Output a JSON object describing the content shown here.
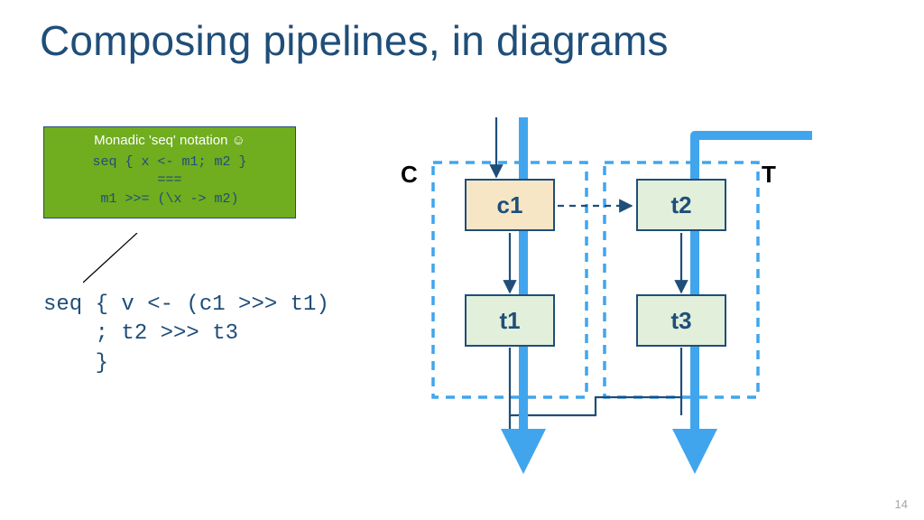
{
  "slide": {
    "title": "Composing pipelines, in diagrams",
    "page_number": "14"
  },
  "callout": {
    "title": "Monadic 'seq' notation ☺",
    "line1": "seq { x <- m1; m2 }",
    "line2": "===",
    "line3": "m1 >>= (\\x -> m2)"
  },
  "code": {
    "text": "seq { v <- (c1 >>> t1)\n    ; t2 >>> t3\n    }"
  },
  "diagram": {
    "group_left_label": "C",
    "group_right_label": "T",
    "nodes": {
      "c1": "c1",
      "t1": "t1",
      "t2": "t2",
      "t3": "t3"
    }
  },
  "colors": {
    "accent_dark": "#1f4e79",
    "callout_bg": "#70ad1f",
    "node_green": "#e2efda",
    "node_tan": "#f6e6c5",
    "pipe_blue": "#41a5ee"
  }
}
